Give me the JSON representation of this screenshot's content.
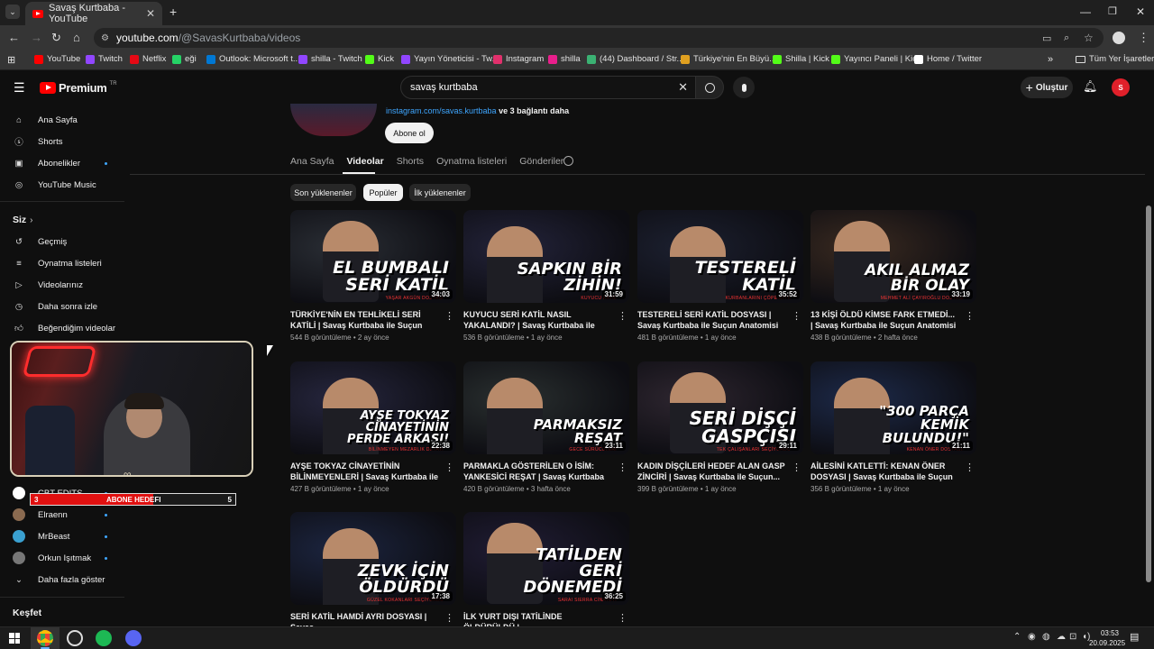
{
  "browser": {
    "tab_title": "Savaş Kurtbaba - YouTube",
    "url_host": "youtube.com",
    "url_path": "/@SavasKurtbaba/videos",
    "bookmarks": [
      {
        "label": "YouTube",
        "color": "#ff0000"
      },
      {
        "label": "Twitch",
        "color": "#9146ff"
      },
      {
        "label": "Netflix",
        "color": "#e50914"
      },
      {
        "label": "eği",
        "color": "#25d366"
      },
      {
        "label": "Outlook: Microsoft t...",
        "color": "#0078d4"
      },
      {
        "label": "shilla - Twitch",
        "color": "#9146ff"
      },
      {
        "label": "Kick",
        "color": "#53fc18"
      },
      {
        "label": "Yayın Yöneticisi - Tw...",
        "color": "#9146ff"
      },
      {
        "label": "Instagram",
        "color": "#e1306c"
      },
      {
        "label": "shilla",
        "color": "#e91e8c"
      },
      {
        "label": "(44) Dashboard / Str...",
        "color": "#3bb273"
      },
      {
        "label": "Türkiye'nin En Büyü...",
        "color": "#e0a020"
      },
      {
        "label": "Shilla | Kick",
        "color": "#53fc18"
      },
      {
        "label": "Yayıncı Paneli | Kick",
        "color": "#53fc18"
      },
      {
        "label": "Home / Twitter",
        "color": "#ffffff"
      }
    ],
    "all_bookmarks": "Tüm Yer İşaretleri"
  },
  "yt": {
    "logo": "Premium",
    "logo_region": "TR",
    "search_value": "savaş kurtbaba",
    "create_label": "Oluştur"
  },
  "sidebar": {
    "main": [
      {
        "label": "Ana Sayfa",
        "icon": "home-icon"
      },
      {
        "label": "Shorts",
        "icon": "shorts-icon"
      },
      {
        "label": "Abonelikler",
        "icon": "subscriptions-icon"
      },
      {
        "label": "YouTube Music",
        "icon": "music-icon"
      }
    ],
    "you_header": "Siz",
    "you": [
      {
        "label": "Geçmiş",
        "icon": "history-icon"
      },
      {
        "label": "Oynatma listeleri",
        "icon": "playlists-icon"
      },
      {
        "label": "Videolarınız",
        "icon": "your-videos-icon"
      },
      {
        "label": "Daha sonra izle",
        "icon": "watch-later-icon"
      },
      {
        "label": "Beğendiğim videolar",
        "icon": "liked-icon"
      }
    ],
    "subs": [
      {
        "label": "CBT EDITS",
        "color": "#ffffff"
      },
      {
        "label": "Elraenn",
        "color": "#8a6a50"
      },
      {
        "label": "MrBeast",
        "color": "#3aa0d0"
      },
      {
        "label": "Orkun Işıtmak",
        "color": "#777777"
      }
    ],
    "show_more": "Daha fazla göster",
    "explore": "Keşfet"
  },
  "overlay": {
    "subgoal_left": "3",
    "subgoal_label": "ABONE HEDEFI",
    "subgoal_right": "5",
    "subgoal_progress": 0.6
  },
  "channel": {
    "link": "instagram.com/savas.kurtbaba",
    "link_more": "ve 3 bağlantı daha",
    "subscribe": "Abone ol",
    "tabs": [
      "Ana Sayfa",
      "Videolar",
      "Shorts",
      "Oynatma listeleri",
      "Gönderiler"
    ],
    "active_tab": "Videolar",
    "chips": [
      "Son yüklenenler",
      "Popüler",
      "İlk yüklenenler"
    ],
    "active_chip": "Popüler"
  },
  "videos": [
    {
      "title": "TÜRKİYE'NİN EN TEHLİKELİ SERİ KATİLİ | Savaş Kurtbaba ile Suçun Anatomisi",
      "meta": "544 B görüntüleme • 2 ay önce",
      "duration": "34:03",
      "thumb_text": "EL BUMBALI SERİ KATİL",
      "thumb_sub": "YAŞAR AKGÜN DOSYASI",
      "bg": "#2a2e35"
    },
    {
      "title": "KUYUCU SERİ KATİL NASIL YAKALANDI? | Savaş Kurtbaba ile Suçun Anatomisi",
      "meta": "536 B görüntüleme • 1 ay önce",
      "duration": "31:59",
      "thumb_text": "SAPKIN BİR ZİHİN!",
      "thumb_sub": "KUYUCU KATİL",
      "bg": "#23233a"
    },
    {
      "title": "TESTERELİ SERİ KATİL DOSYASI | Savaş Kurtbaba ile Suçun Anatomisi",
      "meta": "481 B görüntüleme • 1 ay önce",
      "duration": "35:52",
      "thumb_text": "TESTERELİ KATİL",
      "thumb_sub": "KURBANLARINI ÇÖPE ATTI!",
      "bg": "#1c2030"
    },
    {
      "title": "13 KİŞİ ÖLDÜ KİMSE FARK ETMEDİ... | Savaş Kurtbaba ile Suçun Anatomisi",
      "meta": "438 B görüntüleme • 2 hafta önce",
      "duration": "33:19",
      "thumb_text": "AKIL ALMAZ BİR OLAY",
      "thumb_sub": "MEHMET ALİ ÇAYIROĞLU DOSYASI",
      "bg": "#3a2a20"
    },
    {
      "title": "AYŞE TOKYAZ CİNAYETİNİN BİLİNMEYENLERİ | Savaş Kurtbaba ile İlk 4...",
      "meta": "427 B görüntüleme • 1 ay önce",
      "duration": "22:38",
      "thumb_text": "AYŞE TOKYAZ CİNAYETİNİN PERDE ARKASI!",
      "thumb_sub": "BİLİNMEYEN MEZARLIK DETAYI",
      "bg": "#26263e"
    },
    {
      "title": "PARMAKLA GÖSTERİLEN O İSİM: YANKESİCİ REŞAT | Savaş Kurtbaba ile Suçun Anatomisi",
      "meta": "420 B görüntüleme • 3 hafta önce",
      "duration": "23:11",
      "thumb_text": "PARMAKSIZ REŞAT",
      "thumb_sub": "GECE SÜRÜCÜLERİ",
      "bg": "#2a3030"
    },
    {
      "title": "KADIN DİŞÇİLERİ HEDEF ALAN GASP ZİNCİRİ | Savaş Kurtbaba ile Suçun...",
      "meta": "399 B görüntüleme • 1 ay önce",
      "duration": "29:11",
      "thumb_text": "SERİ DİŞÇİ GASPÇISI",
      "thumb_sub": "TEK ÇALIŞANLARI SEÇİYORDU",
      "bg": "#2e2630"
    },
    {
      "title": "AİLESİNİ KATLETTİ: KENAN ÖNER DOSYASI | Savaş Kurtbaba ile Suçun Anatomisi",
      "meta": "356 B görüntüleme • 1 ay önce",
      "duration": "21:11",
      "thumb_text": "\"300 PARÇA KEMİK BULUNDU!\"",
      "thumb_sub": "KENAN ÖNER DOSYASI:",
      "bg": "#1d2a4a"
    },
    {
      "title": "SERİ KATİL HAMDİ AYRI DOSYASI | Savaş",
      "meta": "",
      "duration": "17:38",
      "thumb_text": "ZEVK İÇİN ÖLDÜRDÜ",
      "thumb_sub": "GÜZEL KOKANLARI SEÇİYORDU",
      "bg": "#1c2540"
    },
    {
      "title": "İLK YURT DIŞI TATİLİNDE ÖLDÜRÜLDÜ |",
      "meta": "",
      "duration": "36:25",
      "thumb_text": "TATİLDEN GERİ DÖNEMEDİ",
      "thumb_sub": "SARAI SIERRA CİNAYETİ",
      "bg": "#201c34"
    }
  ],
  "taskbar": {
    "time": "03:53",
    "date": "20.09.2025"
  }
}
